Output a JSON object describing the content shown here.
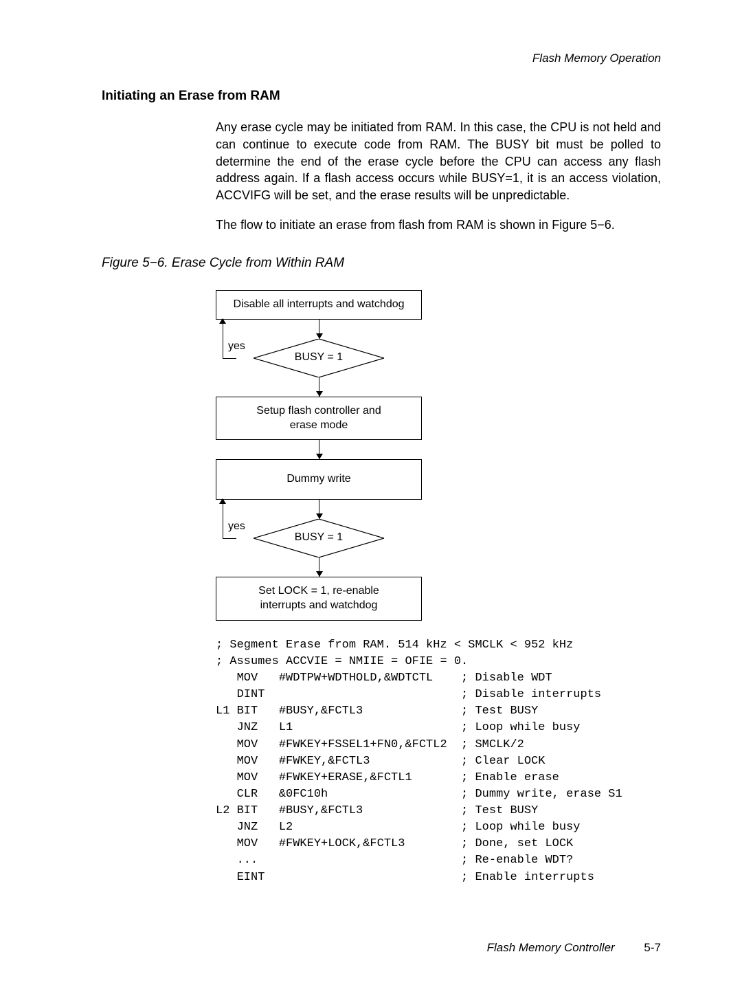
{
  "header": {
    "right": "Flash Memory Operation"
  },
  "section": {
    "title": "Initiating an Erase from RAM",
    "para1": "Any erase cycle may be initiated from RAM. In this case, the CPU is not held and can continue to execute code from RAM. The BUSY bit must be polled to determine the end of the erase cycle before the CPU can access any flash address again. If a flash access occurs while BUSY=1, it is an access violation, ACCVIFG will be set, and the erase results will be unpredictable.",
    "para2": "The flow to initiate an erase from flash from RAM is shown in Figure 5−6."
  },
  "figure": {
    "caption": "Figure 5−6. Erase Cycle from Within RAM"
  },
  "flow": {
    "box1": "Disable all interrupts and watchdog",
    "dec1": "BUSY = 1",
    "yes1": "yes",
    "box2a": "Setup flash controller and",
    "box2b": "erase mode",
    "box3": "Dummy write",
    "dec2": "BUSY = 1",
    "yes2": "yes",
    "box4a": "Set LOCK = 1, re-enable",
    "box4b": "interrupts and watchdog"
  },
  "code": {
    "l01": "; Segment Erase from RAM. 514 kHz < SMCLK < 952 kHz",
    "l02": "; Assumes ACCVIE = NMIIE = OFIE = 0.",
    "l03": "   MOV   #WDTPW+WDTHOLD,&WDTCTL    ; Disable WDT",
    "l04": "   DINT                            ; Disable interrupts",
    "l05": "L1 BIT   #BUSY,&FCTL3              ; Test BUSY",
    "l06": "   JNZ   L1                        ; Loop while busy",
    "l07": "   MOV   #FWKEY+FSSEL1+FN0,&FCTL2  ; SMCLK/2",
    "l08": "   MOV   #FWKEY,&FCTL3             ; Clear LOCK",
    "l09": "   MOV   #FWKEY+ERASE,&FCTL1       ; Enable erase",
    "l10": "   CLR   &0FC10h                   ; Dummy write, erase S1",
    "l11": "L2 BIT   #BUSY,&FCTL3              ; Test BUSY",
    "l12": "   JNZ   L2                        ; Loop while busy",
    "l13": "   MOV   #FWKEY+LOCK,&FCTL3        ; Done, set LOCK",
    "l14": "   ...                             ; Re-enable WDT?",
    "l15": "   EINT                            ; Enable interrupts"
  },
  "footer": {
    "title": "Flash Memory Controller",
    "page": "5-7"
  }
}
